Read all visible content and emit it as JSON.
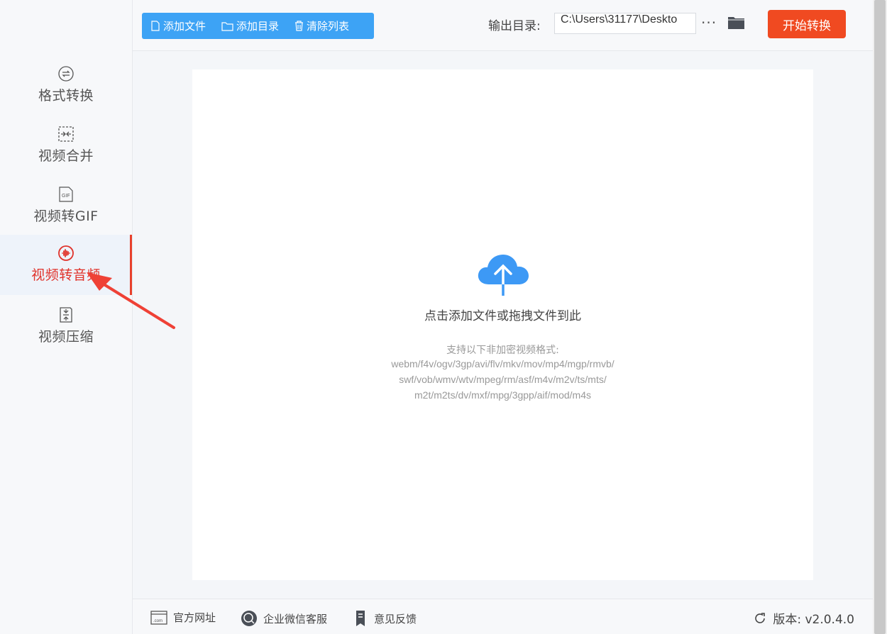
{
  "sidebar": {
    "items": [
      {
        "label": "格式转换",
        "icon": "convert-icon"
      },
      {
        "label": "视频合并",
        "icon": "merge-icon"
      },
      {
        "label": "视频转GIF",
        "icon": "gif-icon"
      },
      {
        "label": "视频转音频",
        "icon": "audio-wave-icon",
        "active": true
      },
      {
        "label": "视频压缩",
        "icon": "compress-icon"
      }
    ]
  },
  "toolbar": {
    "add_file": "添加文件",
    "add_folder": "添加目录",
    "clear_list": "清除列表",
    "output_label": "输出目录:",
    "output_path": "C:\\Users\\31177\\Deskto",
    "more": "···",
    "start": "开始转换"
  },
  "drop": {
    "title": "点击添加文件或拖拽文件到此",
    "formats_title": "支持以下非加密视频格式:",
    "formats_lines": [
      "webm/f4v/ogv/3gp/avi/flv/mkv/mov/mp4/mgp/rmvb/",
      "swf/vob/wmv/wtv/mpeg/rm/asf/m4v/m2v/ts/mts/",
      "m2t/m2ts/dv/mxf/mpg/3gpp/aif/mod/m4s"
    ]
  },
  "footer": {
    "website": "官方网址",
    "wechat": "企业微信客服",
    "feedback": "意见反馈",
    "version": "版本:  v2.0.4.0"
  },
  "colors": {
    "accent_blue": "#3da3f5",
    "start_orange": "#f04a21",
    "active_red": "#e0322a"
  }
}
